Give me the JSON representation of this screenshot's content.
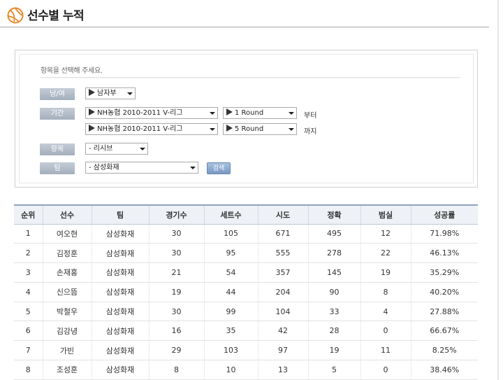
{
  "page": {
    "title": "선수별 누적"
  },
  "search": {
    "heading": "항목을 선택해 주세요.",
    "labels": {
      "gender": "남/여",
      "period": "기간",
      "item": "항목",
      "team": "팀"
    },
    "gender_value": "남자부",
    "period_start_season": "NH농협 2010-2011 V-리그",
    "period_start_round": "1 Round",
    "period_end_season": "NH농협 2010-2011 V-리그",
    "period_end_round": "5 Round",
    "from_text": "부터",
    "to_text": "까지",
    "item_value": "- 리시브",
    "team_value": "- 삼성화재",
    "search_button": "검색"
  },
  "table": {
    "columns": [
      "순위",
      "선수",
      "팀",
      "경기수",
      "세트수",
      "시도",
      "정확",
      "범실",
      "성공률"
    ],
    "rows": [
      [
        "1",
        "여오현",
        "삼성화재",
        "30",
        "105",
        "671",
        "495",
        "12",
        "71.98%"
      ],
      [
        "2",
        "김정훈",
        "삼성화재",
        "30",
        "95",
        "555",
        "278",
        "22",
        "46.13%"
      ],
      [
        "3",
        "손재홍",
        "삼성화재",
        "21",
        "54",
        "357",
        "145",
        "19",
        "35.29%"
      ],
      [
        "4",
        "신으뜸",
        "삼성화재",
        "19",
        "44",
        "204",
        "90",
        "8",
        "40.20%"
      ],
      [
        "5",
        "박철우",
        "삼성화재",
        "30",
        "99",
        "104",
        "33",
        "4",
        "27.88%"
      ],
      [
        "6",
        "김강녕",
        "삼성화재",
        "16",
        "35",
        "42",
        "28",
        "0",
        "66.67%"
      ],
      [
        "7",
        "가빈",
        "삼성화재",
        "29",
        "103",
        "97",
        "19",
        "11",
        "8.25%"
      ],
      [
        "8",
        "조성훈",
        "삼성화재",
        "8",
        "10",
        "13",
        "5",
        "0",
        "38.46%"
      ]
    ]
  },
  "colors": {
    "logo": "#e8892a",
    "header_rule": "#8fa3c0",
    "label_bg": "#a4afbd",
    "button_bg": "#7898c2"
  }
}
